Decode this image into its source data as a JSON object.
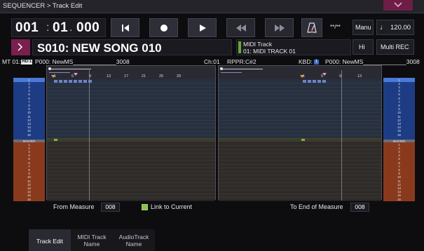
{
  "titlebar": {
    "title": "SEQUENCER > Track Edit"
  },
  "location": {
    "measure": "001",
    "beat": "01",
    "tick": "000",
    "sep1": ":",
    "sep2": "."
  },
  "transport": {
    "time_signature": "**/**",
    "tempo_mode": "Manu",
    "tempo_icon": "quarter-note",
    "tempo": "120.00",
    "rec_quality": "Hi",
    "rec_mode": "Multi REC"
  },
  "song": {
    "name": "S010: NEW SONG 010"
  },
  "midi_track": {
    "line1": "MIDI Track",
    "line2": "01: MIDI TRACK 01",
    "color": "#6aa63a"
  },
  "info": {
    "track": "MT 01:",
    "bank_badge": "HD-1",
    "program": "P000: NewMS_____________3008",
    "channel": "Ch:01",
    "rppr": "RPPR:C#2",
    "kbd_label": "KBD:",
    "kbd_badge": "1",
    "kbd_program": "P000: NewMS_____________3008"
  },
  "left_panel": {
    "ruler": [
      "1",
      "5",
      "9",
      "13",
      "17",
      "21",
      "25",
      "29"
    ]
  },
  "right_panel": {
    "ruler": [
      "1",
      "5",
      "9",
      "13"
    ]
  },
  "track_list": {
    "midi": [
      "1",
      "2",
      "3",
      "4",
      "5",
      "6",
      "7",
      "8",
      "9",
      "10",
      "11",
      "12",
      "13",
      "14",
      "15",
      "16"
    ],
    "master": "MASTER",
    "audio": [
      "1",
      "2",
      "3",
      "4",
      "5",
      "6",
      "7",
      "8",
      "9",
      "10",
      "11",
      "12",
      "13",
      "14",
      "15",
      "16"
    ]
  },
  "range": {
    "from_label": "From Measure",
    "from_value": "008",
    "link_label": "Link to Current",
    "link_checked": true,
    "to_label": "To End of Measure",
    "to_value": "008"
  },
  "tabs": [
    {
      "label1": "Track Edit",
      "label2": ""
    },
    {
      "label1": "MIDI Track",
      "label2": "Name"
    },
    {
      "label1": "AudioTrack",
      "label2": "Name"
    }
  ],
  "colors": {
    "accent": "#7a1f4e",
    "midi_track": "#1e3c84",
    "audio_track": "#8a3a1c",
    "checkbox": "#8cbf4c"
  }
}
